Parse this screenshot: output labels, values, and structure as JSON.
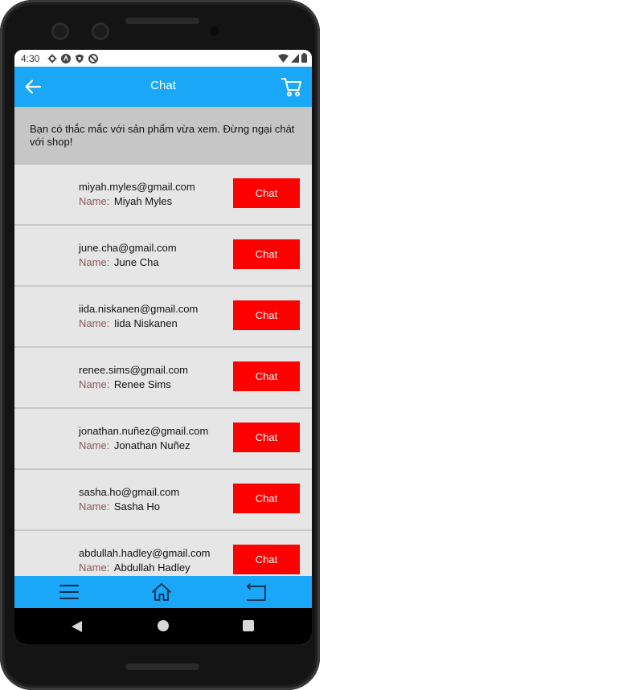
{
  "status_bar": {
    "time": "4:30"
  },
  "header": {
    "title": "Chat"
  },
  "banner": {
    "text": "Bạn có thắc mắc với sản phẩm vừa xem. Đừng ngại chát với shop!"
  },
  "contacts": [
    {
      "email": "miyah.myles@gmail.com",
      "name_label": "Name:",
      "name": "Miyah Myles",
      "button": "Chat"
    },
    {
      "email": "june.cha@gmail.com",
      "name_label": "Name:",
      "name": "June Cha",
      "button": "Chat"
    },
    {
      "email": "iida.niskanen@gmail.com",
      "name_label": "Name:",
      "name": "Iida Niskanen",
      "button": "Chat"
    },
    {
      "email": "renee.sims@gmail.com",
      "name_label": "Name:",
      "name": "Renee Sims",
      "button": "Chat"
    },
    {
      "email": "jonathan.nuñez@gmail.com",
      "name_label": "Name:",
      "name": "Jonathan Nuñez",
      "button": "Chat"
    },
    {
      "email": "sasha.ho@gmail.com",
      "name_label": "Name:",
      "name": "Sasha Ho",
      "button": "Chat"
    },
    {
      "email": "abdullah.hadley@gmail.com",
      "name_label": "Name:",
      "name": "Abdullah Hadley",
      "button": "Chat"
    }
  ],
  "icons": {
    "back": "arrow-left-icon",
    "cart": "cart-icon",
    "menu": "menu-icon",
    "home": "home-icon",
    "return": "return-icon"
  },
  "colors": {
    "app_bar": "#1aa7f7",
    "chat_button": "#ff0000",
    "banner_bg": "#c6c6c6",
    "list_bg": "#e6e6e6"
  }
}
